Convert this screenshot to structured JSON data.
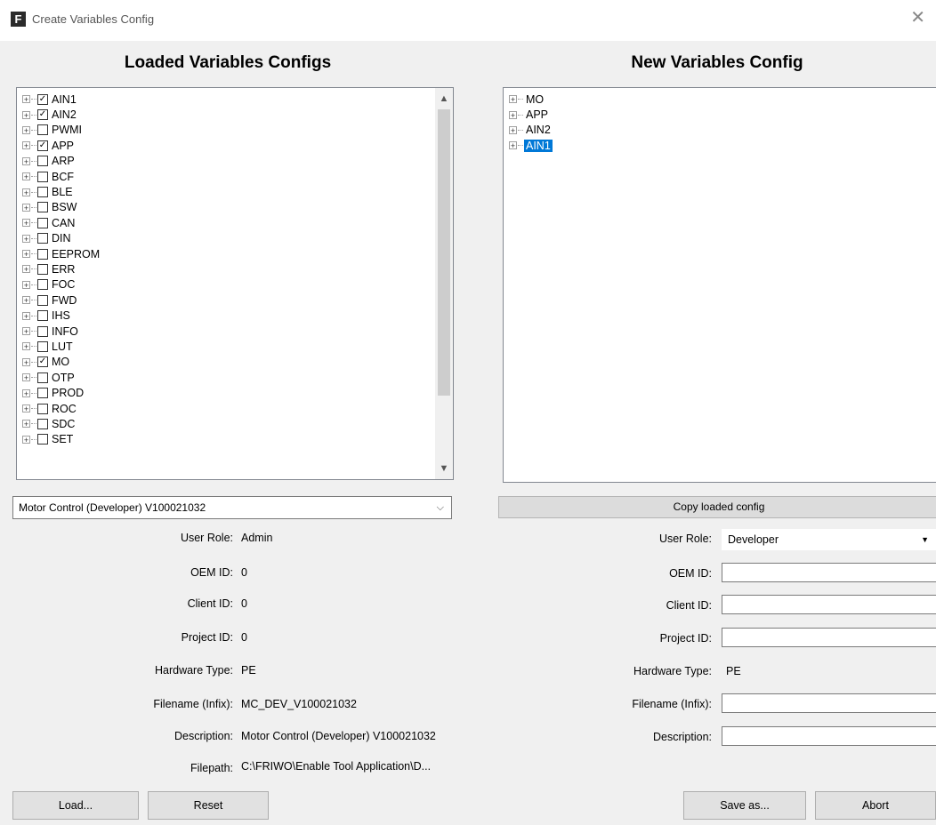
{
  "window": {
    "title": "Create Variables Config",
    "icon_letter": "F",
    "close": "✕"
  },
  "left": {
    "heading": "Loaded Variables Configs",
    "tree": [
      {
        "label": "AIN1",
        "checked": true
      },
      {
        "label": "AIN2",
        "checked": true
      },
      {
        "label": "PWMI",
        "checked": false
      },
      {
        "label": "APP",
        "checked": true
      },
      {
        "label": "ARP",
        "checked": false
      },
      {
        "label": "BCF",
        "checked": false
      },
      {
        "label": "BLE",
        "checked": false
      },
      {
        "label": "BSW",
        "checked": false
      },
      {
        "label": "CAN",
        "checked": false
      },
      {
        "label": "DIN",
        "checked": false
      },
      {
        "label": "EEPROM",
        "checked": false
      },
      {
        "label": "ERR",
        "checked": false
      },
      {
        "label": "FOC",
        "checked": false
      },
      {
        "label": "FWD",
        "checked": false
      },
      {
        "label": "IHS",
        "checked": false
      },
      {
        "label": "INFO",
        "checked": false
      },
      {
        "label": "LUT",
        "checked": false
      },
      {
        "label": "MO",
        "checked": true
      },
      {
        "label": "OTP",
        "checked": false
      },
      {
        "label": "PROD",
        "checked": false
      },
      {
        "label": "ROC",
        "checked": false
      },
      {
        "label": "SDC",
        "checked": false
      },
      {
        "label": "SET",
        "checked": false
      }
    ],
    "config_select": "Motor Control (Developer) V100021032",
    "fields": [
      {
        "label": "User Role:",
        "value": "Admin"
      },
      {
        "label": "OEM ID:",
        "value": "0"
      },
      {
        "label": "Client ID:",
        "value": "0"
      },
      {
        "label": "Project ID:",
        "value": "0"
      },
      {
        "label": "Hardware Type:",
        "value": "PE"
      },
      {
        "label": "Filename (Infix):",
        "value": "MC_DEV_V100021032"
      },
      {
        "label": "Description:",
        "value": "Motor Control (Developer) V100021032"
      },
      {
        "label": "Filepath:",
        "value": "C:\\FRIWO\\Enable Tool Application\\D..."
      }
    ],
    "buttons": {
      "load": "Load...",
      "reset": "Reset"
    }
  },
  "right": {
    "heading": "New Variables Config",
    "tree": [
      {
        "label": "MO",
        "selected": false
      },
      {
        "label": "APP",
        "selected": false
      },
      {
        "label": "AIN2",
        "selected": false
      },
      {
        "label": "AIN1",
        "selected": true
      }
    ],
    "copy_button": "Copy loaded config",
    "fields": {
      "user_role_label": "User Role:",
      "user_role_value": "Developer",
      "oem_label": "OEM ID:",
      "oem_value": "",
      "client_label": "Client ID:",
      "client_value": "",
      "project_label": "Project ID:",
      "project_value": "",
      "hardware_label": "Hardware Type:",
      "hardware_value": "PE",
      "filename_label": "Filename (Infix):",
      "filename_value": "",
      "description_label": "Description:",
      "description_value": ""
    },
    "buttons": {
      "save": "Save as...",
      "abort": "Abort"
    }
  },
  "colors": {
    "selection": "#0078d7",
    "window_bg": "#f0f0f0"
  }
}
